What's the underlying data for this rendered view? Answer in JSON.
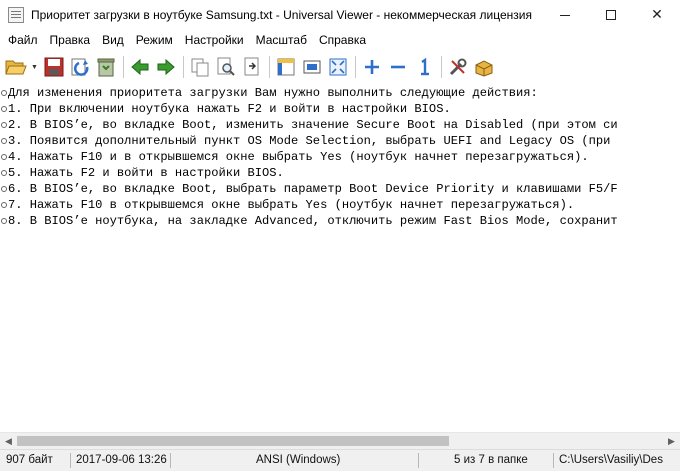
{
  "window": {
    "title": "Приоритет загрузки в ноутбуке Samsung.txt - Universal Viewer - некоммерческая лицензия",
    "close_glyph": "✕"
  },
  "menu": [
    {
      "label": "Файл"
    },
    {
      "label": "Правка"
    },
    {
      "label": "Вид"
    },
    {
      "label": "Режим"
    },
    {
      "label": "Настройки"
    },
    {
      "label": "Масштаб"
    },
    {
      "label": "Справка"
    }
  ],
  "toolbar": {
    "icons": [
      "open-file-icon",
      "save-icon",
      "reload-icon",
      "recycle-bin-icon",
      "previous-file-icon",
      "next-file-icon",
      "copy-icon",
      "find-icon",
      "export-icon",
      "text-mode-icon",
      "fullscreen-icon",
      "fit-window-icon",
      "zoom-in-icon",
      "zoom-out-icon",
      "original-size-icon",
      "tools-icon",
      "plugin-icon"
    ],
    "colors": {
      "accent_green": "#3a9b2e",
      "accent_blue": "#2e6fc9",
      "accent_red": "#c0302a"
    }
  },
  "document": {
    "lines": [
      {
        "text": "Для изменения приоритета загрузки Вам нужно выполнить следующие действия:"
      },
      {
        "text": "1. При включении ноутбука нажать F2 и войти в настройки BIOS."
      },
      {
        "text": "2. В BIOS’е, во вкладке Boot, изменить значение Secure Boot на Disabled (при этом си"
      },
      {
        "text": "3. Появится дополнительный пункт OS Mode Selection, выбрать UEFI and Legacy OS (при"
      },
      {
        "text": "4. Нажать F10 и в открывшемся окне выбрать Yes (ноутбук начнет перезагружаться)."
      },
      {
        "text": "5. Нажать F2 и войти в настройки BIOS."
      },
      {
        "text": "6. В BIOS’е, во вкладке Boot, выбрать параметр Boot Device Priority и клавишами F5/F"
      },
      {
        "text": "7. Нажать F10 в открывшемся окне выбрать Yes (ноутбук начнет перезагружаться)."
      },
      {
        "text": "8. В BIOS’е ноутбука, на закладке Advanced, отключить режим Fast Bios Mode, сохранит"
      }
    ]
  },
  "scrollbar": {
    "left_arrow": "◀",
    "right_arrow": "▶",
    "position": 0.0
  },
  "status": {
    "size": "907 байт",
    "datetime": "2017-09-06 13:26",
    "encoding": "ANSI (Windows)",
    "position": "5 из 7 в папке",
    "path": "C:\\Users\\Vasiliy\\Des"
  }
}
